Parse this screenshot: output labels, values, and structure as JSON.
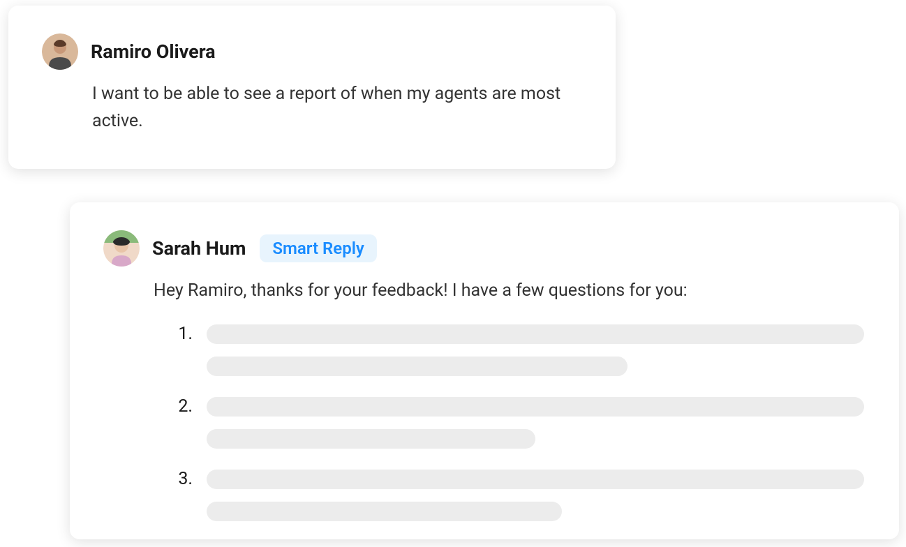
{
  "feedback": {
    "author": "Ramiro Olivera",
    "message": "I want to be able to see a report of when my agents are most active."
  },
  "reply": {
    "author": "Sarah Hum",
    "badge": "Smart Reply",
    "message": "Hey Ramiro, thanks for your feedback! I have a few questions for you:",
    "list_numbers": [
      "1.",
      "2.",
      "3."
    ]
  }
}
